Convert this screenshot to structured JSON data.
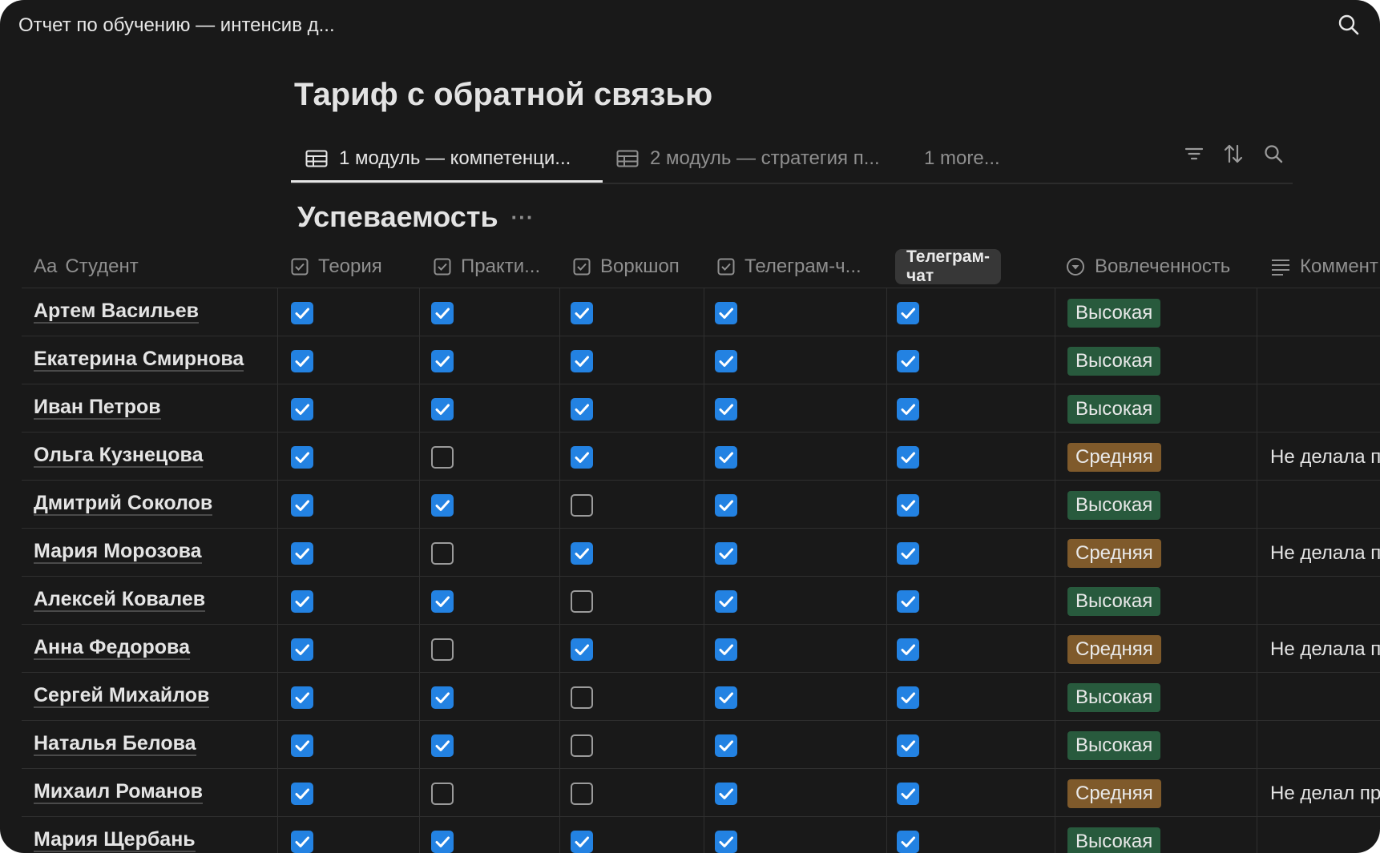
{
  "window": {
    "title": "Отчет по обучению — интенсив д..."
  },
  "page": {
    "title": "Тариф с обратной связью"
  },
  "tabs": [
    {
      "label": "1 модуль — компетенци...",
      "icon": "table-icon",
      "active": true
    },
    {
      "label": "2 модуль — стратегия п...",
      "icon": "table-icon",
      "active": false
    },
    {
      "label": "1 more...",
      "active": false
    }
  ],
  "toolbar": {
    "filter_icon": "filter-icon",
    "sort_icon": "sort-icon",
    "search_icon": "search-icon"
  },
  "section": {
    "title": "Успеваемость",
    "menu": "···"
  },
  "columns": {
    "student": {
      "prefix": "Aa",
      "label": "Студент"
    },
    "theory": {
      "label": "Теория"
    },
    "practice": {
      "label": "Практи..."
    },
    "workshop": {
      "label": "Воркшоп"
    },
    "telegram1": {
      "label": "Телеграм-ч..."
    },
    "telegram2": {
      "label": "Телеграм-чат"
    },
    "engagement": {
      "label": "Вовлеченность"
    },
    "comment": {
      "label": "Коммент"
    }
  },
  "colors": {
    "checkbox": "#2382e2",
    "tag_high": "#285a3d",
    "tag_mid": "#7f5a2b",
    "background": "#191919"
  },
  "rows": [
    {
      "name": "Артем Васильев",
      "theory": true,
      "practice": true,
      "workshop": true,
      "tg1": true,
      "tg2": true,
      "engagement": "Высокая",
      "level": "high",
      "comment": ""
    },
    {
      "name": "Екатерина Смирнова",
      "theory": true,
      "practice": true,
      "workshop": true,
      "tg1": true,
      "tg2": true,
      "engagement": "Высокая",
      "level": "high",
      "comment": ""
    },
    {
      "name": "Иван Петров",
      "theory": true,
      "practice": true,
      "workshop": true,
      "tg1": true,
      "tg2": true,
      "engagement": "Высокая",
      "level": "high",
      "comment": ""
    },
    {
      "name": "Ольга Кузнецова",
      "theory": true,
      "practice": false,
      "workshop": true,
      "tg1": true,
      "tg2": true,
      "engagement": "Средняя",
      "level": "mid",
      "comment": "Не делала п"
    },
    {
      "name": "Дмитрий Соколов",
      "theory": true,
      "practice": true,
      "workshop": false,
      "tg1": true,
      "tg2": true,
      "engagement": "Высокая",
      "level": "high",
      "comment": ""
    },
    {
      "name": "Мария Морозова",
      "theory": true,
      "practice": false,
      "workshop": true,
      "tg1": true,
      "tg2": true,
      "engagement": "Средняя",
      "level": "mid",
      "comment": "Не делала п"
    },
    {
      "name": "Алексей Ковалев",
      "theory": true,
      "practice": true,
      "workshop": false,
      "tg1": true,
      "tg2": true,
      "engagement": "Высокая",
      "level": "high",
      "comment": ""
    },
    {
      "name": "Анна Федорова",
      "theory": true,
      "practice": false,
      "workshop": true,
      "tg1": true,
      "tg2": true,
      "engagement": "Средняя",
      "level": "mid",
      "comment": "Не делала п"
    },
    {
      "name": "Сергей Михайлов",
      "theory": true,
      "practice": true,
      "workshop": false,
      "tg1": true,
      "tg2": true,
      "engagement": "Высокая",
      "level": "high",
      "comment": ""
    },
    {
      "name": "Наталья Белова",
      "theory": true,
      "practice": true,
      "workshop": false,
      "tg1": true,
      "tg2": true,
      "engagement": "Высокая",
      "level": "high",
      "comment": ""
    },
    {
      "name": "Михаил Романов",
      "theory": true,
      "practice": false,
      "workshop": false,
      "tg1": true,
      "tg2": true,
      "engagement": "Средняя",
      "level": "mid",
      "comment": "Не делал пр"
    },
    {
      "name": "Мария Щербань",
      "theory": true,
      "practice": true,
      "workshop": true,
      "tg1": true,
      "tg2": true,
      "engagement": "Высокая",
      "level": "high",
      "comment": ""
    }
  ]
}
